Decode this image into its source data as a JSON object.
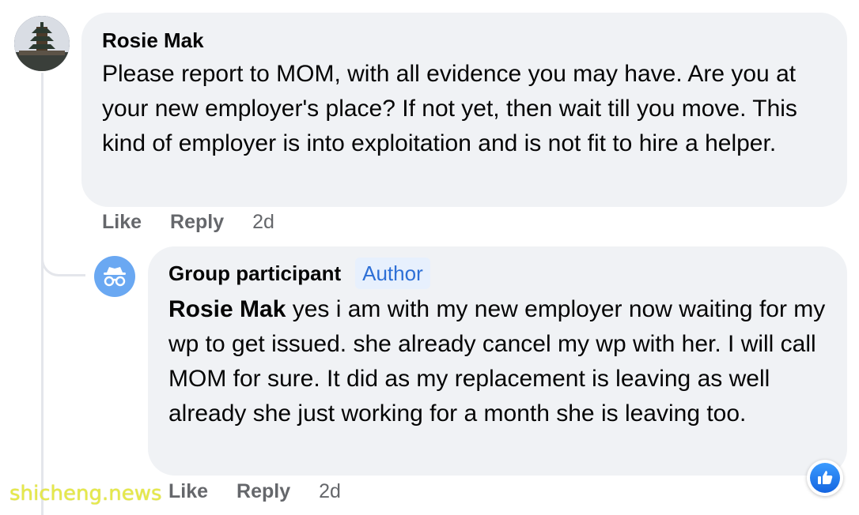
{
  "comment": {
    "author": "Rosie Mak",
    "text": "Please report to MOM, with all evidence you may have. Are you at your new employer's place? If not yet, then wait till you move. This kind of employer is into exploitation and is not fit to hire a helper.",
    "actions": {
      "like": "Like",
      "reply": "Reply",
      "time": "2d"
    },
    "avatar_icon": "pagoda-photo"
  },
  "reply": {
    "author": "Group participant",
    "badge": "Author",
    "mention": "Rosie Mak",
    "text": " yes i am with my new employer now waiting for my wp to get issued. she already cancel my wp with her. I will call MOM for sure. It did as my replacement is leaving as well already she just working for a month she is leaving too.",
    "actions": {
      "like": "Like",
      "reply": "Reply",
      "time": "2d"
    },
    "avatar_icon": "anonymous-incognito-icon",
    "reaction_icon": "thumbs-up-icon"
  },
  "watermark": "shicheng.news",
  "colors": {
    "bubble": "#f0f2f5",
    "accent": "#2d6fd6",
    "meta": "#65676b"
  }
}
